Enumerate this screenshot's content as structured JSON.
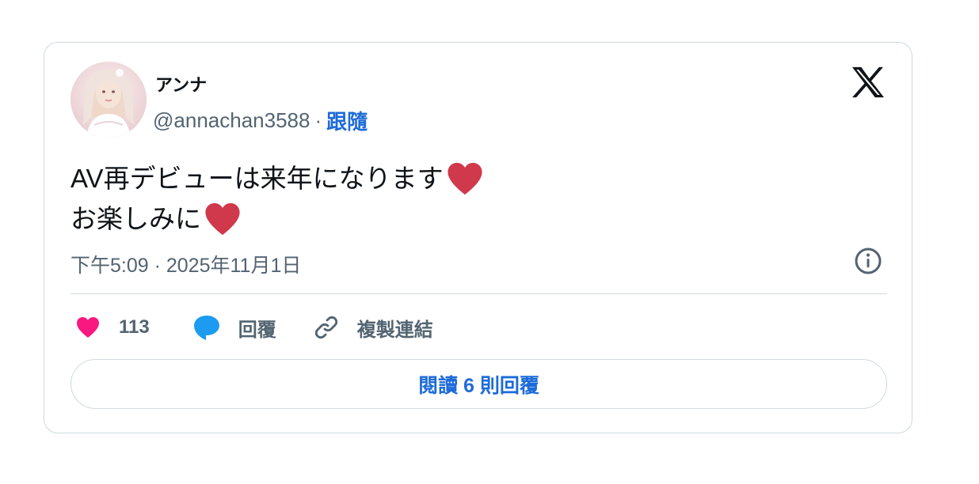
{
  "author": {
    "display_name": "アンナ",
    "handle": "@annachan3588",
    "separator": "·",
    "follow_label": "跟隨"
  },
  "tweet": {
    "line1": "AV再デビューは来年になります",
    "line2": "お楽しみに",
    "emoji": "red-heart-emoji"
  },
  "meta": {
    "timestamp": "下午5:09 · 2025年11月1日"
  },
  "actions": {
    "like_count": "113",
    "reply_label": "回覆",
    "copy_link_label": "複製連結"
  },
  "read_replies_label": "閱讀 6 則回覆",
  "colors": {
    "link": "#1d6bd9",
    "muted": "#536471",
    "like": "#f91880",
    "reply": "#1d9bf0",
    "heart_emoji": "#d0394b",
    "border": "#cfd9de"
  },
  "icons": [
    "x-logo-icon",
    "info-icon",
    "heart-icon",
    "speech-bubble-icon",
    "link-icon"
  ]
}
